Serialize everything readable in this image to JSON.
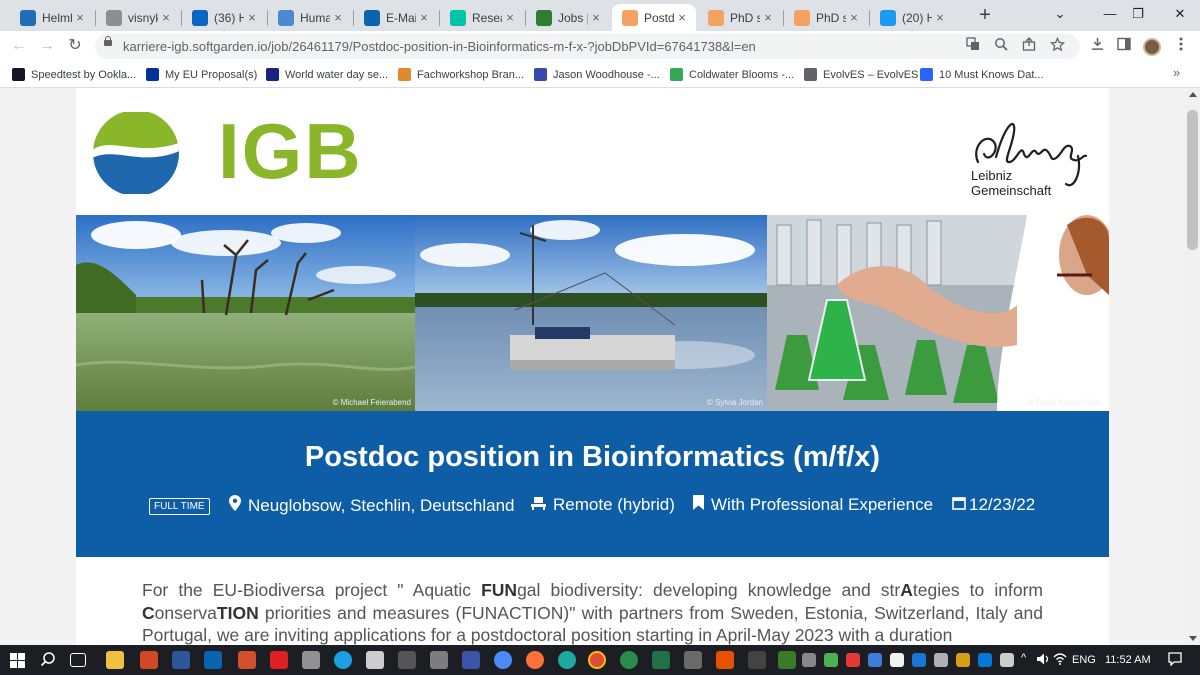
{
  "tabs": [
    {
      "title": "Helmh",
      "color": "#1f6fb5"
    },
    {
      "title": "visnyk",
      "color": "#8e8e8e"
    },
    {
      "title": "(36) H",
      "color": "#0a66c2"
    },
    {
      "title": "Huma",
      "color": "#4a8bd0"
    },
    {
      "title": "E-Mail",
      "color": "#0a64ad"
    },
    {
      "title": "Resear",
      "color": "#00c4a7"
    },
    {
      "title": "Jobs |",
      "color": "#2e7d32"
    },
    {
      "title": "Postdo",
      "color": "#f4a261",
      "active": true
    },
    {
      "title": "PhD st",
      "color": "#f4a261"
    },
    {
      "title": "PhD st",
      "color": "#f4a261"
    },
    {
      "title": "(20) H",
      "color": "#1d9bf0"
    }
  ],
  "window_controls": {
    "new_tab": "+",
    "chevron": "⌄",
    "minimize": "—",
    "restore": "❐",
    "close": "✕"
  },
  "toolbar": {
    "back": "←",
    "forward": "→",
    "reload": "↻",
    "url": "karriere-igb.softgarden.io/job/26461179/Postdoc-position-in-Bioinformatics-m-f-x-?jobDbPVId=67641738&l=en"
  },
  "bookmarks": [
    {
      "label": "Speedtest by Ookla...",
      "color": "#141526"
    },
    {
      "label": "My EU Proposal(s)",
      "color": "#003399"
    },
    {
      "label": "World water day se...",
      "color": "#1a237e"
    },
    {
      "label": "Fachworkshop Bran...",
      "color": "#e08a2c"
    },
    {
      "label": "Jason Woodhouse -...",
      "color": "#3949ab"
    },
    {
      "label": "Coldwater Blooms -...",
      "color": "#34a853"
    },
    {
      "label": "EvolvES – EvolvES",
      "color": "#5f6368"
    },
    {
      "label": "10 Must Knows Dat...",
      "color": "#2962ff"
    }
  ],
  "page": {
    "logo_text": "IGB",
    "leibniz_line1": "Leibniz",
    "leibniz_line2": "Gemeinschaft",
    "photo_credits": [
      "© Michael Feierabend",
      "© Sylvia Jordan",
      "© David Ausserhofer"
    ],
    "job_title": "Postdoc position in Bioinformatics (m/f/x)",
    "badge": "FULL TIME",
    "location": "Neuglobsow, Stechlin, Deutschland",
    "remote": "Remote (hybrid)",
    "experience": "With Professional Experience",
    "date": "12/23/22",
    "body": {
      "p1": "For the EU-Biodiversa project \" Aquatic ",
      "b1": "FUN",
      "p2": "gal biodiversity: developing knowledge and str",
      "b2": "A",
      "p3": "tegies to inform ",
      "b3": "C",
      "p4": "onserva",
      "b4": "TION",
      "p5": " priorities and measures (FUNACTION)\" with partners from Sweden, Estonia, Switzerland, Italy and Portugal, we are inviting applications for a postdoctoral position starting in April-May 2023 with a duration"
    }
  },
  "taskbar": {
    "lang": "ENG",
    "time": "11:52 AM"
  }
}
